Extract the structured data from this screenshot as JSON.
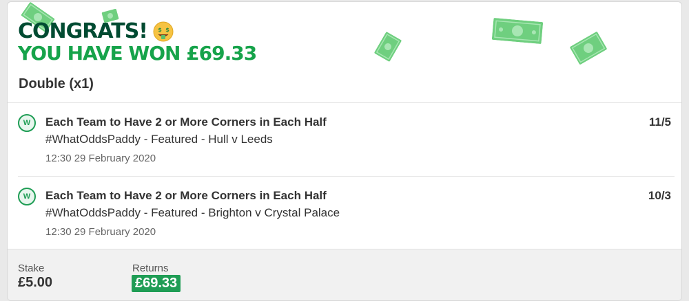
{
  "header": {
    "congrats": "CONGRATS!",
    "won_text": "YOU HAVE WON £69.33",
    "bet_type": "Double (x1)"
  },
  "selections": [
    {
      "title": "Each Team to Have 2 or More Corners in Each Half",
      "event": "#WhatOddsPaddy - Featured - Hull v Leeds",
      "time": "12:30 29 February 2020",
      "odds": "11/5",
      "badge": "W"
    },
    {
      "title": "Each Team to Have 2 or More Corners in Each Half",
      "event": "#WhatOddsPaddy - Featured - Brighton v Crystal Palace",
      "time": "12:30 29 February 2020",
      "odds": "10/3",
      "badge": "W"
    }
  ],
  "footer": {
    "stake_label": "Stake",
    "stake_value": "£5.00",
    "returns_label": "Returns",
    "returns_value": "£69.33"
  },
  "colors": {
    "dark_green": "#014b32",
    "bright_green": "#16a34a",
    "badge_green": "#1f9d55",
    "money_green": "#6fcf7f"
  }
}
